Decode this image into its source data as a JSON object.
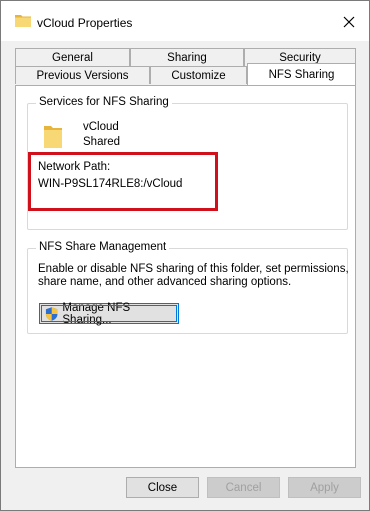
{
  "window": {
    "title": "vCloud Properties"
  },
  "tabs": {
    "row1": [
      "General",
      "Sharing",
      "Security"
    ],
    "row2": [
      "Previous Versions",
      "Customize",
      "NFS Sharing"
    ],
    "active": "NFS Sharing"
  },
  "services_group": {
    "legend": "Services for NFS Sharing",
    "folder_name": "vCloud",
    "status": "Shared",
    "network_path_label": "Network Path:",
    "network_path_value": "WIN-P9SL174RLE8:/vCloud"
  },
  "management_group": {
    "legend": "NFS Share Management",
    "description_line1": "Enable or disable NFS sharing of this folder, set permissions,",
    "description_line2": "share name, and other advanced sharing options.",
    "manage_button": "Manage NFS Sharing..."
  },
  "footer": {
    "close": "Close",
    "cancel": "Cancel",
    "apply": "Apply"
  },
  "icons": {
    "title": "folder-icon",
    "close": "close-icon",
    "folder": "folder-icon",
    "shield": "shield-icon"
  },
  "colors": {
    "highlight": "#d0111b",
    "folder": "#f8d775",
    "button_focus": "#0078d7"
  }
}
